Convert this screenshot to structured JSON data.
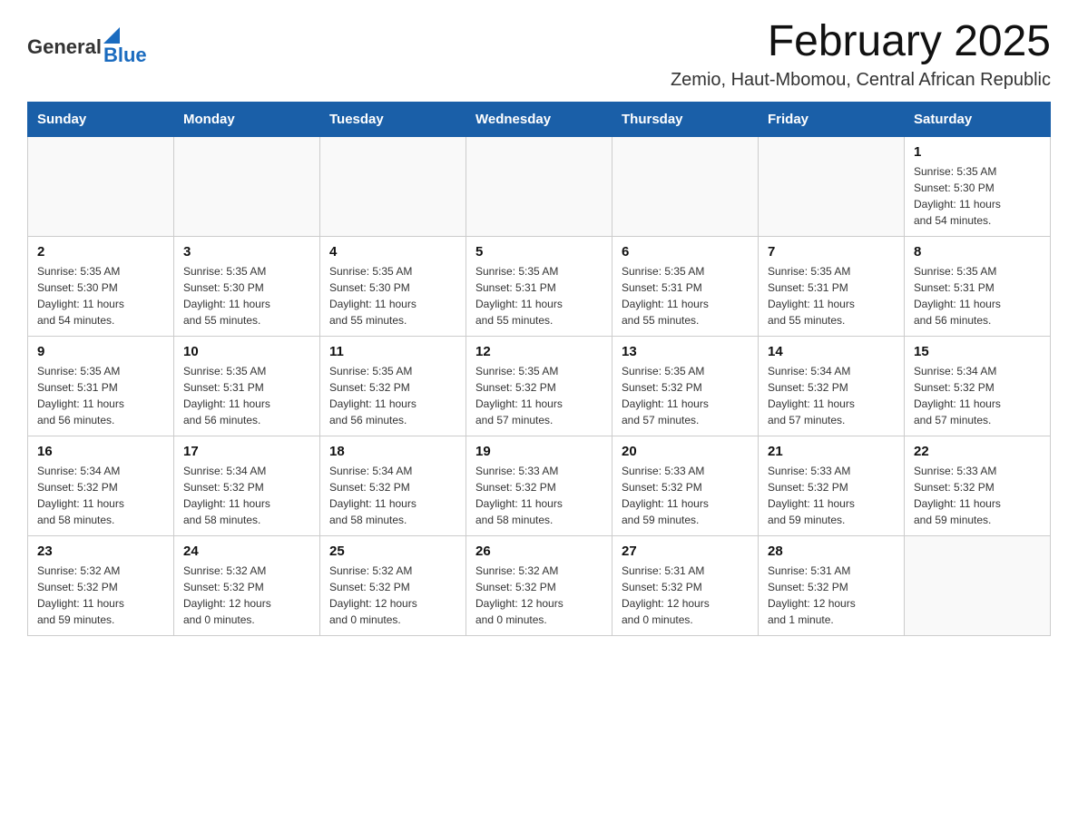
{
  "header": {
    "logo_general": "General",
    "logo_blue": "Blue",
    "title": "February 2025",
    "subtitle": "Zemio, Haut-Mbomou, Central African Republic"
  },
  "days_of_week": [
    "Sunday",
    "Monday",
    "Tuesday",
    "Wednesday",
    "Thursday",
    "Friday",
    "Saturday"
  ],
  "weeks": [
    [
      {
        "day": "",
        "info": ""
      },
      {
        "day": "",
        "info": ""
      },
      {
        "day": "",
        "info": ""
      },
      {
        "day": "",
        "info": ""
      },
      {
        "day": "",
        "info": ""
      },
      {
        "day": "",
        "info": ""
      },
      {
        "day": "1",
        "info": "Sunrise: 5:35 AM\nSunset: 5:30 PM\nDaylight: 11 hours\nand 54 minutes."
      }
    ],
    [
      {
        "day": "2",
        "info": "Sunrise: 5:35 AM\nSunset: 5:30 PM\nDaylight: 11 hours\nand 54 minutes."
      },
      {
        "day": "3",
        "info": "Sunrise: 5:35 AM\nSunset: 5:30 PM\nDaylight: 11 hours\nand 55 minutes."
      },
      {
        "day": "4",
        "info": "Sunrise: 5:35 AM\nSunset: 5:30 PM\nDaylight: 11 hours\nand 55 minutes."
      },
      {
        "day": "5",
        "info": "Sunrise: 5:35 AM\nSunset: 5:31 PM\nDaylight: 11 hours\nand 55 minutes."
      },
      {
        "day": "6",
        "info": "Sunrise: 5:35 AM\nSunset: 5:31 PM\nDaylight: 11 hours\nand 55 minutes."
      },
      {
        "day": "7",
        "info": "Sunrise: 5:35 AM\nSunset: 5:31 PM\nDaylight: 11 hours\nand 55 minutes."
      },
      {
        "day": "8",
        "info": "Sunrise: 5:35 AM\nSunset: 5:31 PM\nDaylight: 11 hours\nand 56 minutes."
      }
    ],
    [
      {
        "day": "9",
        "info": "Sunrise: 5:35 AM\nSunset: 5:31 PM\nDaylight: 11 hours\nand 56 minutes."
      },
      {
        "day": "10",
        "info": "Sunrise: 5:35 AM\nSunset: 5:31 PM\nDaylight: 11 hours\nand 56 minutes."
      },
      {
        "day": "11",
        "info": "Sunrise: 5:35 AM\nSunset: 5:32 PM\nDaylight: 11 hours\nand 56 minutes."
      },
      {
        "day": "12",
        "info": "Sunrise: 5:35 AM\nSunset: 5:32 PM\nDaylight: 11 hours\nand 57 minutes."
      },
      {
        "day": "13",
        "info": "Sunrise: 5:35 AM\nSunset: 5:32 PM\nDaylight: 11 hours\nand 57 minutes."
      },
      {
        "day": "14",
        "info": "Sunrise: 5:34 AM\nSunset: 5:32 PM\nDaylight: 11 hours\nand 57 minutes."
      },
      {
        "day": "15",
        "info": "Sunrise: 5:34 AM\nSunset: 5:32 PM\nDaylight: 11 hours\nand 57 minutes."
      }
    ],
    [
      {
        "day": "16",
        "info": "Sunrise: 5:34 AM\nSunset: 5:32 PM\nDaylight: 11 hours\nand 58 minutes."
      },
      {
        "day": "17",
        "info": "Sunrise: 5:34 AM\nSunset: 5:32 PM\nDaylight: 11 hours\nand 58 minutes."
      },
      {
        "day": "18",
        "info": "Sunrise: 5:34 AM\nSunset: 5:32 PM\nDaylight: 11 hours\nand 58 minutes."
      },
      {
        "day": "19",
        "info": "Sunrise: 5:33 AM\nSunset: 5:32 PM\nDaylight: 11 hours\nand 58 minutes."
      },
      {
        "day": "20",
        "info": "Sunrise: 5:33 AM\nSunset: 5:32 PM\nDaylight: 11 hours\nand 59 minutes."
      },
      {
        "day": "21",
        "info": "Sunrise: 5:33 AM\nSunset: 5:32 PM\nDaylight: 11 hours\nand 59 minutes."
      },
      {
        "day": "22",
        "info": "Sunrise: 5:33 AM\nSunset: 5:32 PM\nDaylight: 11 hours\nand 59 minutes."
      }
    ],
    [
      {
        "day": "23",
        "info": "Sunrise: 5:32 AM\nSunset: 5:32 PM\nDaylight: 11 hours\nand 59 minutes."
      },
      {
        "day": "24",
        "info": "Sunrise: 5:32 AM\nSunset: 5:32 PM\nDaylight: 12 hours\nand 0 minutes."
      },
      {
        "day": "25",
        "info": "Sunrise: 5:32 AM\nSunset: 5:32 PM\nDaylight: 12 hours\nand 0 minutes."
      },
      {
        "day": "26",
        "info": "Sunrise: 5:32 AM\nSunset: 5:32 PM\nDaylight: 12 hours\nand 0 minutes."
      },
      {
        "day": "27",
        "info": "Sunrise: 5:31 AM\nSunset: 5:32 PM\nDaylight: 12 hours\nand 0 minutes."
      },
      {
        "day": "28",
        "info": "Sunrise: 5:31 AM\nSunset: 5:32 PM\nDaylight: 12 hours\nand 1 minute."
      },
      {
        "day": "",
        "info": ""
      }
    ]
  ]
}
